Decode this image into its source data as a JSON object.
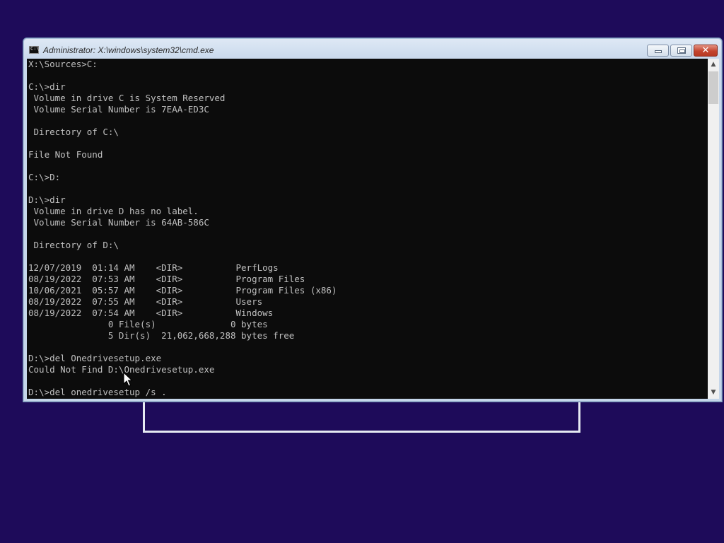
{
  "window": {
    "title": "Administrator: X:\\windows\\system32\\cmd.exe",
    "app_icon_glyph": "C:\\",
    "close_glyph": "✕",
    "scroll_up_glyph": "▲",
    "scroll_down_glyph": "▼"
  },
  "console": {
    "lines": [
      "X:\\Sources>C:",
      "",
      "C:\\>dir",
      " Volume in drive C is System Reserved",
      " Volume Serial Number is 7EAA-ED3C",
      "",
      " Directory of C:\\",
      "",
      "File Not Found",
      "",
      "C:\\>D:",
      "",
      "D:\\>dir",
      " Volume in drive D has no label.",
      " Volume Serial Number is 64AB-586C",
      "",
      " Directory of D:\\",
      "",
      "12/07/2019  01:14 AM    <DIR>          PerfLogs",
      "08/19/2022  07:53 AM    <DIR>          Program Files",
      "10/06/2021  05:57 AM    <DIR>          Program Files (x86)",
      "08/19/2022  07:55 AM    <DIR>          Users",
      "08/19/2022  07:54 AM    <DIR>          Windows",
      "               0 File(s)              0 bytes",
      "               5 Dir(s)  21,062,668,288 bytes free",
      "",
      "D:\\>del Onedrivesetup.exe",
      "Could Not Find D:\\Onedrivesetup.exe",
      "",
      "D:\\>del onedrivesetup /s ."
    ]
  },
  "colors": {
    "desktop_background": "#1e0b5a",
    "console_background": "#0c0c0c",
    "console_text": "#c0c0c0"
  }
}
